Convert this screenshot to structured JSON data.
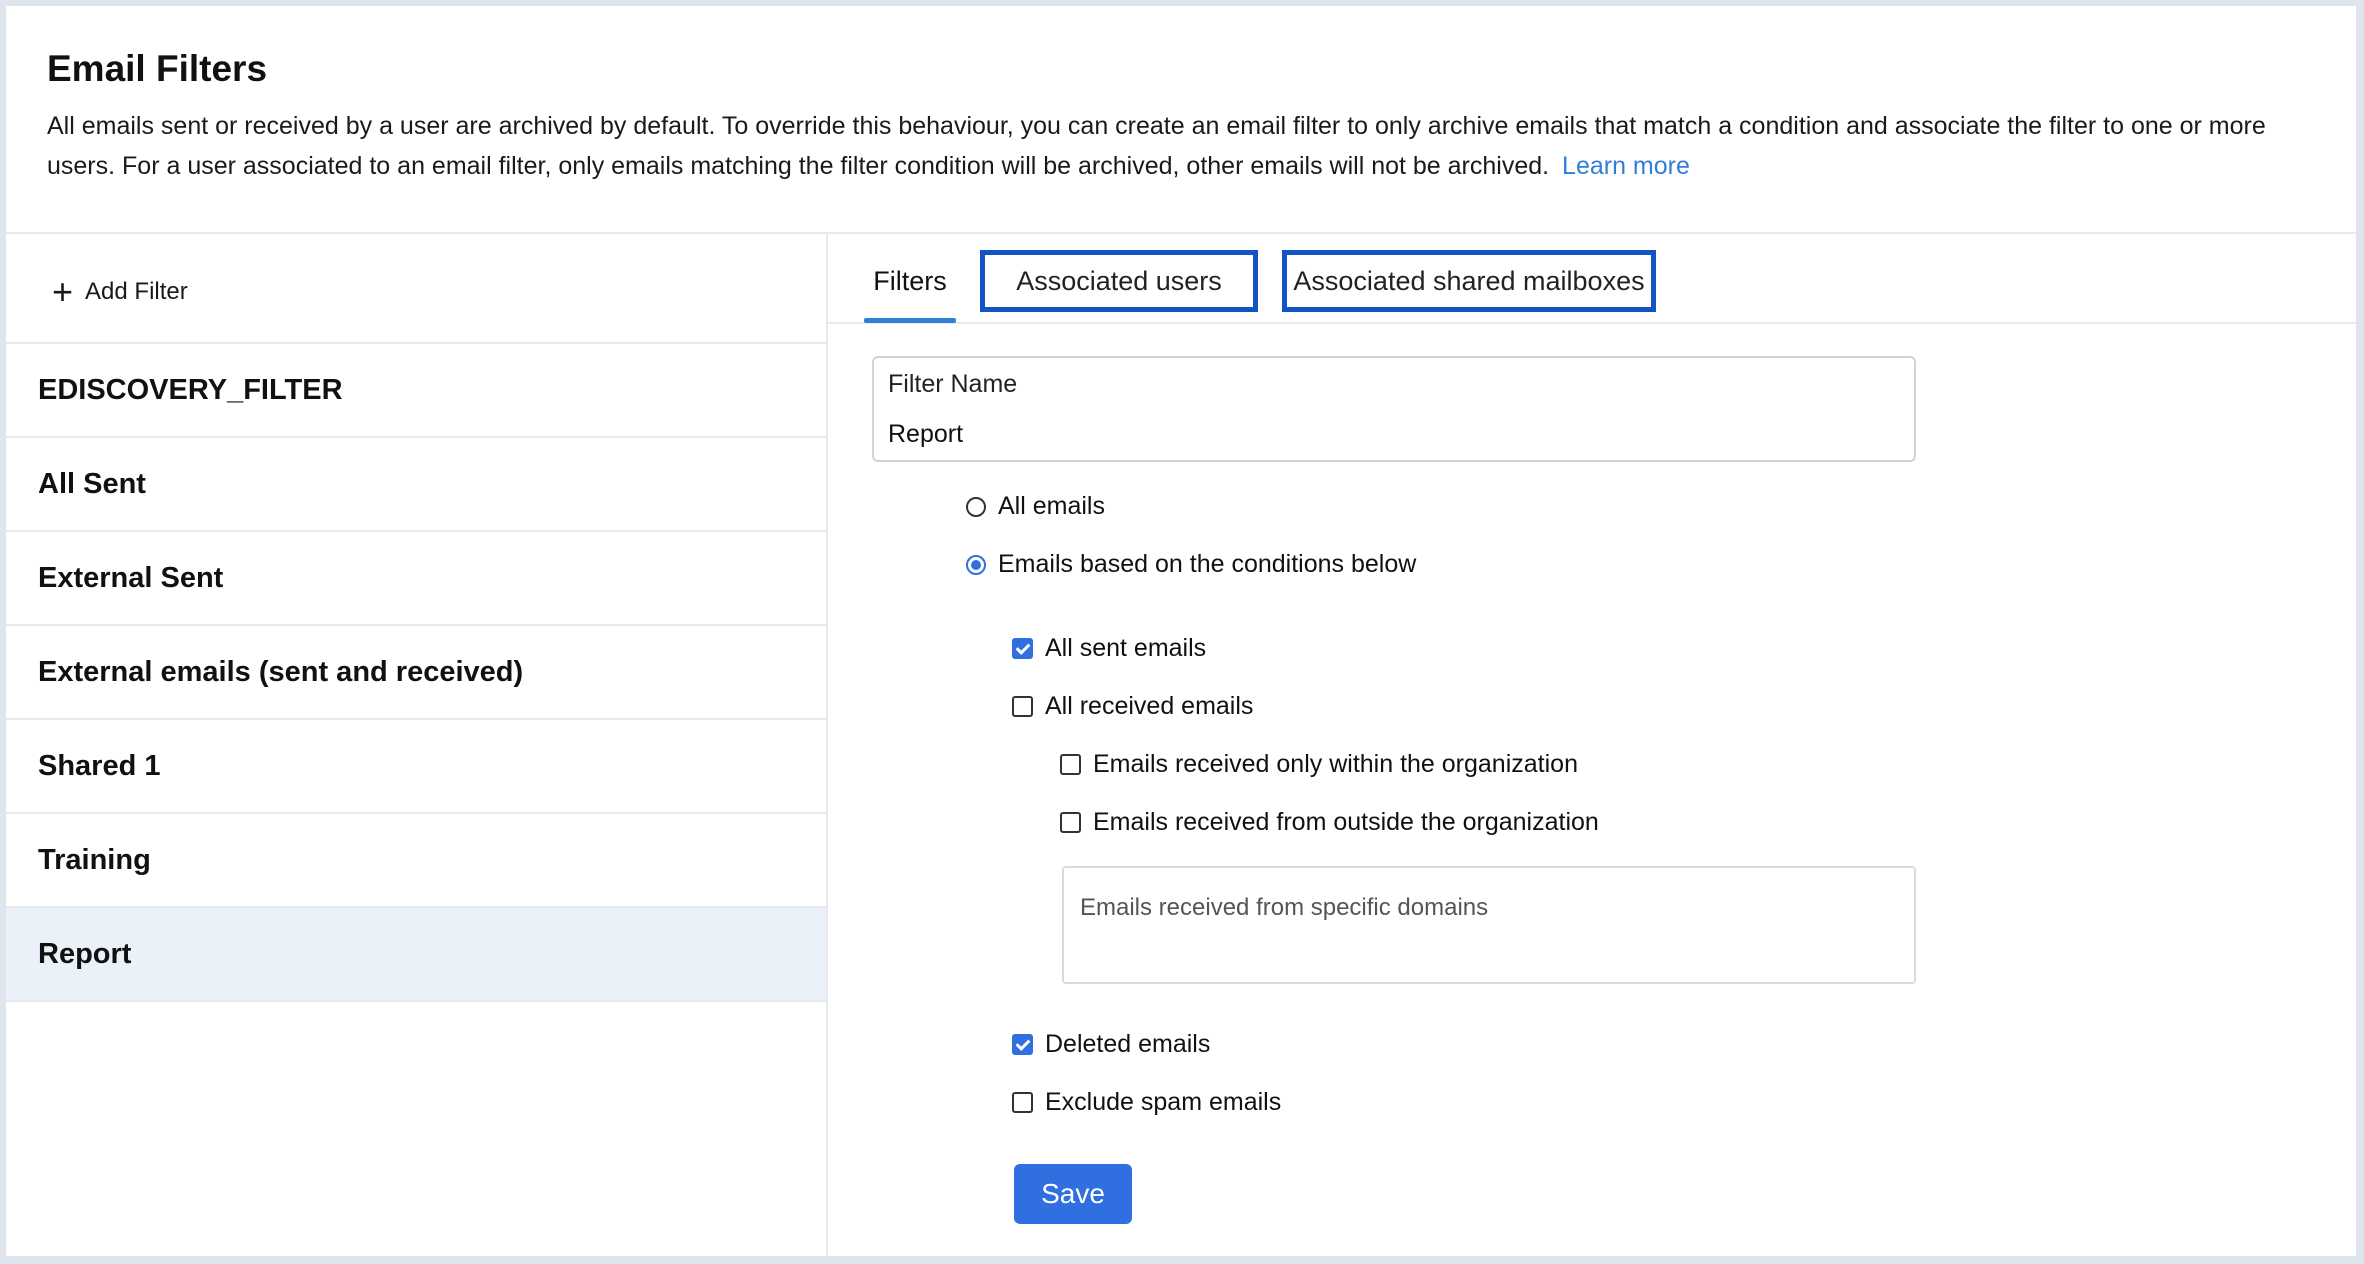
{
  "header": {
    "title": "Email Filters",
    "description": "All emails sent or received by a user are archived by default. To override this behaviour, you can create an email filter to only archive emails that match a condition and associate the filter to one or more users. For a user associated to an email filter, only emails matching the filter condition will be archived, other emails will not be archived.",
    "learn_more": "Learn more"
  },
  "sidebar": {
    "add_filter_label": "Add Filter",
    "add_icon": "plus-icon",
    "filters": [
      {
        "label": "EDISCOVERY_FILTER"
      },
      {
        "label": "All Sent"
      },
      {
        "label": "External Sent"
      },
      {
        "label": "External emails (sent and received)"
      },
      {
        "label": "Shared 1"
      },
      {
        "label": "Training"
      },
      {
        "label": "Report",
        "selected": true
      }
    ]
  },
  "tabs": {
    "filters": "Filters",
    "associated_users": "Associated users",
    "associated_shared_mailboxes": "Associated shared mailboxes",
    "active": "Filters"
  },
  "form": {
    "filter_name_label": "Filter Name",
    "filter_name_value": "Report",
    "scope": {
      "all_emails": "All emails",
      "conditional": "Emails based on the conditions below",
      "selected": "conditional"
    },
    "conditions": {
      "all_sent": {
        "label": "All sent emails",
        "checked": true
      },
      "all_received": {
        "label": "All received emails",
        "checked": false
      },
      "received_within_org": {
        "label": "Emails received only within the organization",
        "checked": false
      },
      "received_outside_org": {
        "label": "Emails received from outside the organization",
        "checked": false
      },
      "specific_domains_placeholder": "Emails received from specific domains",
      "deleted": {
        "label": "Deleted emails",
        "checked": true
      },
      "exclude_spam": {
        "label": "Exclude spam emails",
        "checked": false
      }
    },
    "save_label": "Save"
  },
  "colors": {
    "accent": "#2f6fe0",
    "link": "#2f7ed8",
    "tab_highlight_border": "#1253c6",
    "selected_row_bg": "#eaf1f9"
  }
}
